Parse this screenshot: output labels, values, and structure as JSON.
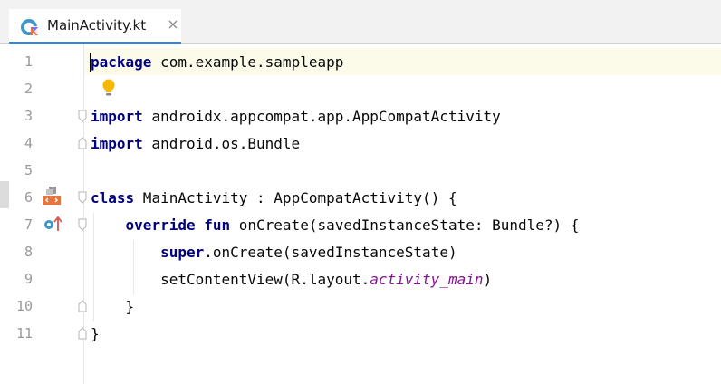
{
  "tab": {
    "filename": "MainActivity.kt"
  },
  "icons": {
    "file_icon": "kotlin-file-icon",
    "close": "close-icon",
    "bulb": "lightbulb-icon",
    "layout": "layout-preview-icon",
    "override": "override-method-icon"
  },
  "code": {
    "lines": [
      {
        "num": "1",
        "kw": "package",
        "rest": " com.example.sampleapp"
      },
      {
        "num": "2"
      },
      {
        "num": "3",
        "kw": "import",
        "rest": " androidx.appcompat.app.AppCompatActivity"
      },
      {
        "num": "4",
        "kw": "import",
        "rest": " android.os.Bundle"
      },
      {
        "num": "5"
      },
      {
        "num": "6",
        "kw": "class",
        "rest": " MainActivity : AppCompatActivity() {"
      },
      {
        "num": "7",
        "indent": "    ",
        "kw": "override fun",
        "rest": " onCreate(savedInstanceState: Bundle?) {"
      },
      {
        "num": "8",
        "indent": "        ",
        "kw": "super",
        "rest": ".onCreate(savedInstanceState)"
      },
      {
        "num": "9",
        "indent": "        ",
        "pre": "setContentView(R.layout.",
        "italic": "activity_main",
        "post": ")"
      },
      {
        "num": "10",
        "indent": "    ",
        "rest": "}"
      },
      {
        "num": "11",
        "rest": "}"
      }
    ]
  }
}
